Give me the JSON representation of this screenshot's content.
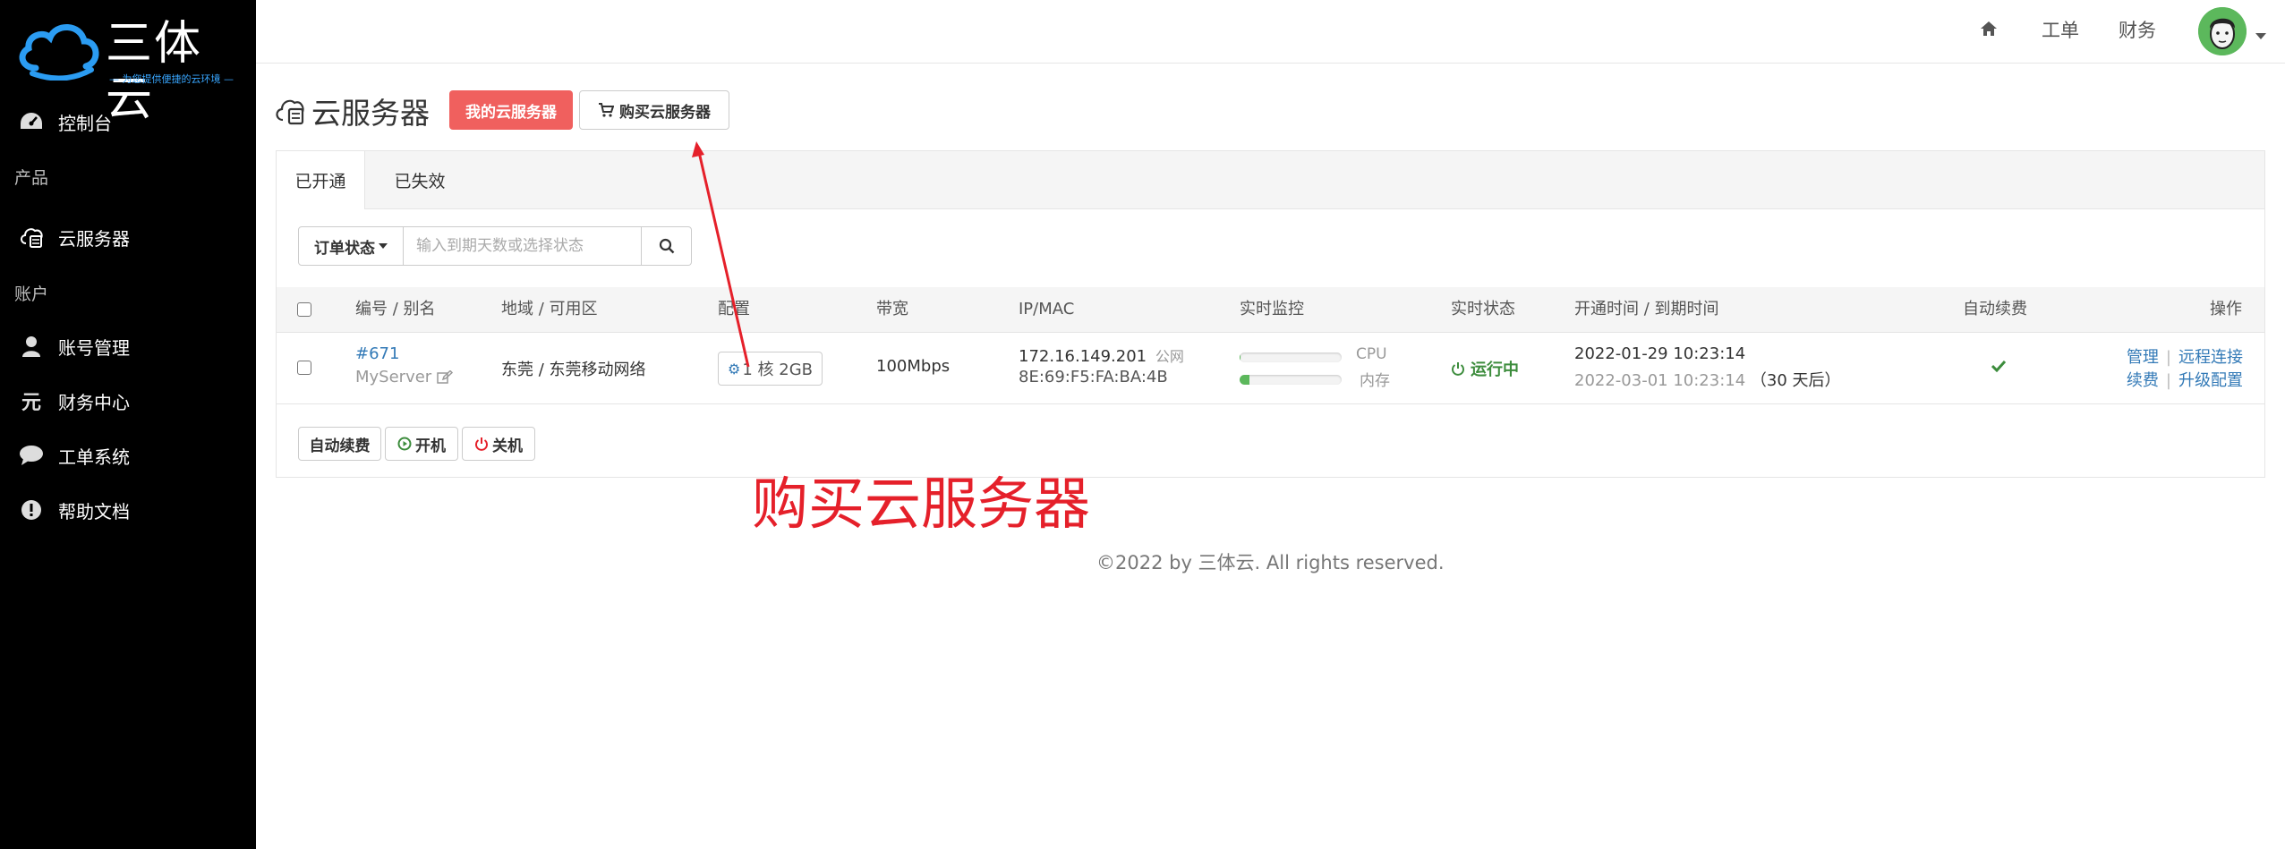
{
  "brand": {
    "name": "三体云",
    "slogan": "— 为您提供便捷的云环境 —"
  },
  "sidebar": {
    "items": [
      {
        "label": "控制台",
        "icon": "dashboard-icon"
      },
      {
        "label": "云服务器",
        "icon": "cloud-server-icon"
      },
      {
        "label": "账号管理",
        "icon": "user-icon"
      },
      {
        "label": "财务中心",
        "icon": "yuan-icon"
      },
      {
        "label": "工单系统",
        "icon": "chat-bubble-icon"
      },
      {
        "label": "帮助文档",
        "icon": "exclamation-icon"
      }
    ],
    "groups": [
      "产品",
      "账户"
    ]
  },
  "header": {
    "home_icon": "home-icon",
    "links": [
      "工单",
      "财务"
    ]
  },
  "page": {
    "title": "云服务器",
    "btn_my": "我的云服务器",
    "btn_buy": "购买云服务器"
  },
  "tabs": [
    "已开通",
    "已失效"
  ],
  "filter": {
    "status_label": "订单状态",
    "search_placeholder": "输入到期天数或选择状态"
  },
  "table": {
    "headers": [
      "编号 / 别名",
      "地域 / 可用区",
      "配置",
      "带宽",
      "IP/MAC",
      "实时监控",
      "实时状态",
      "开通时间 / 到期时间",
      "自动续费",
      "操作"
    ],
    "row": {
      "id": "#671",
      "alias": "MyServer",
      "region": "东莞 / 东莞移动网络",
      "config": "1 核 2GB",
      "bandwidth": "100Mbps",
      "ip": "172.16.149.201",
      "ip_type": "公网",
      "mac": "8E:69:F5:FA:BA:4B",
      "cpu_label": "CPU",
      "mem_label": "内存",
      "cpu_usage": 0.01,
      "mem_usage": 0.1,
      "status": "运行中",
      "open_time": "2022-01-29 10:23:14",
      "expire_time": "2022-03-01 10:23:14",
      "remaining": "（30 天后）",
      "actions": [
        "管理",
        "远程连接",
        "续费",
        "升级配置"
      ]
    }
  },
  "bottom_actions": [
    "自动续费",
    "开机",
    "关机"
  ],
  "annotation": "购买云服务器",
  "footer": "©2022 by 三体云. All rights reserved.",
  "colors": {
    "sidebar_bg": "#000000",
    "primary_red": "#f0605e",
    "link_blue": "#337ab7",
    "success_green": "#3c8c3c",
    "annotation_red": "#e5202a"
  }
}
